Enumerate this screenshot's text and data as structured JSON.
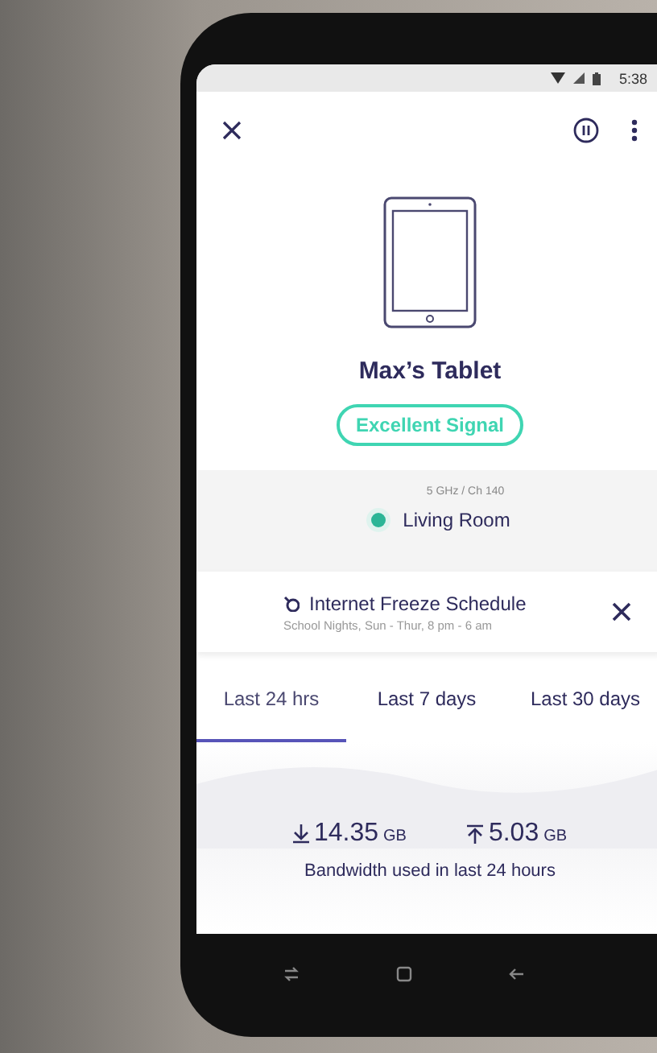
{
  "status_bar": {
    "time": "5:38"
  },
  "device": {
    "name": "Max’s Tablet",
    "signal": "Excellent Signal"
  },
  "connection": {
    "band": "5 GHz / Ch 140",
    "node": "Living Room"
  },
  "schedule": {
    "title": "Internet Freeze Schedule",
    "detail": "School Nights, Sun - Thur, 8 pm - 6 am"
  },
  "tabs": [
    {
      "label": "Last 24 hrs",
      "selected": true
    },
    {
      "label": "Last 7 days",
      "selected": false
    },
    {
      "label": "Last 30 days",
      "selected": false
    }
  ],
  "bandwidth": {
    "download": {
      "value": "14.35",
      "unit": "GB"
    },
    "upload": {
      "value": "5.03",
      "unit": "GB"
    },
    "caption": "Bandwidth used in last 24 hours"
  }
}
